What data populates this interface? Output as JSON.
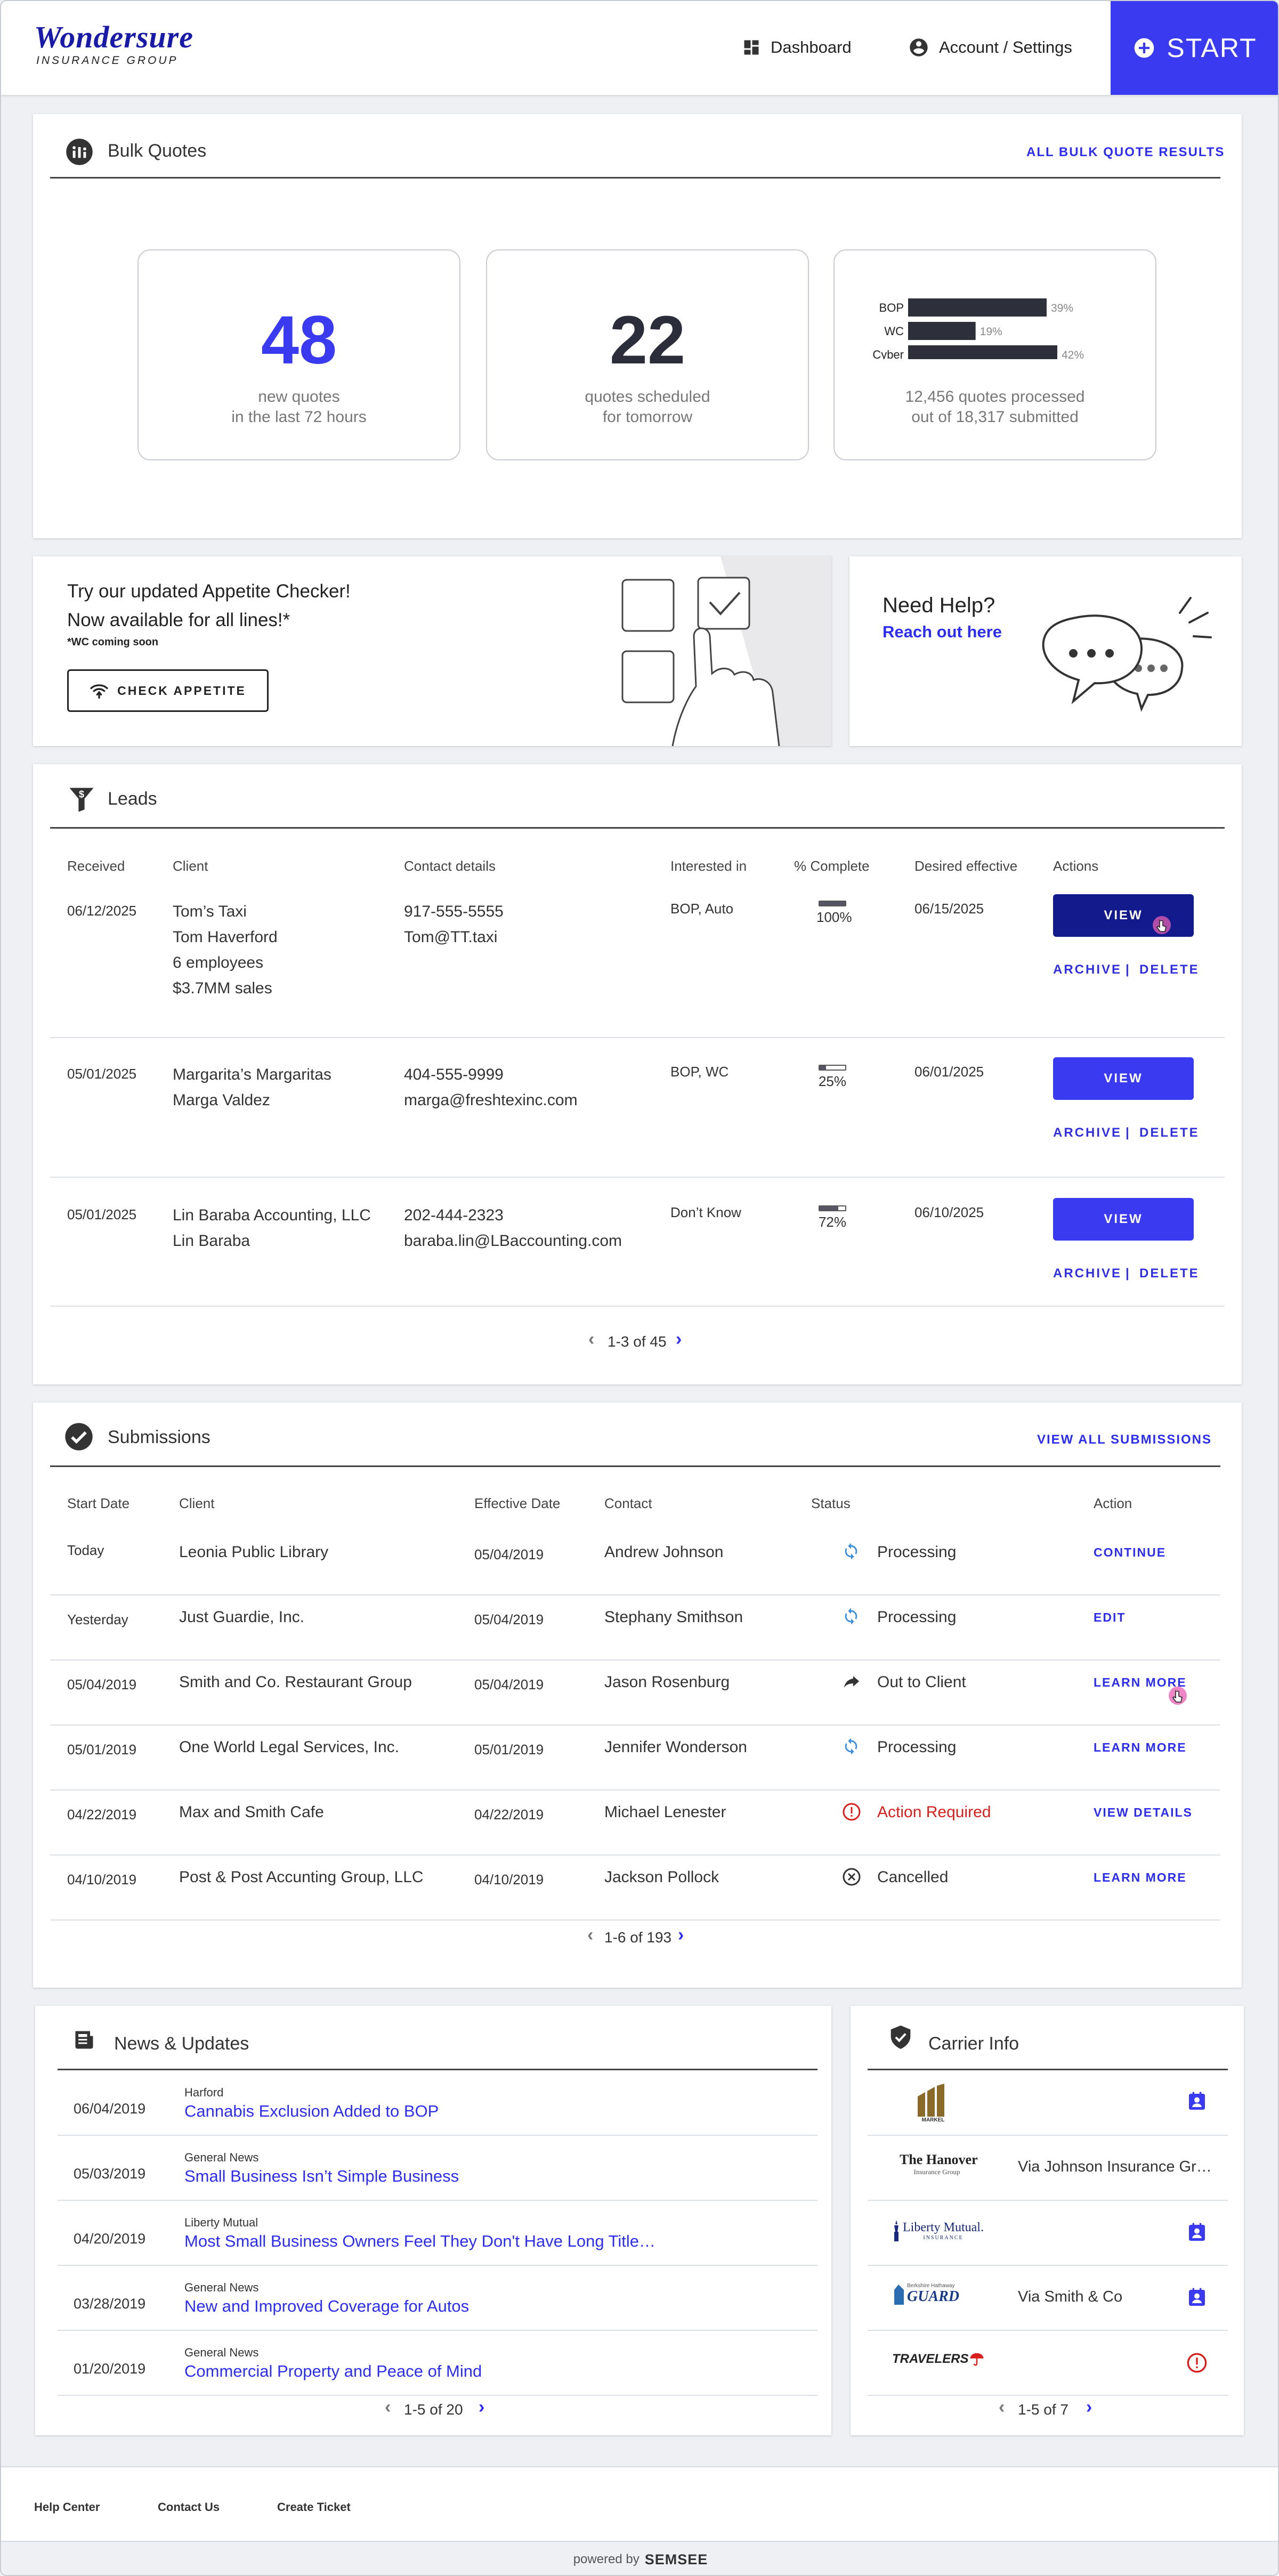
{
  "brand": {
    "name": "Wondersure",
    "tagline": "INSURANCE GROUP"
  },
  "nav": {
    "dashboard": "Dashboard",
    "account": "Account / Settings",
    "start": "START"
  },
  "bulk_quotes": {
    "title": "Bulk Quotes",
    "link": "ALL BULK QUOTE RESULTS",
    "stat1": {
      "value": "48",
      "line1": "new quotes",
      "line2": "in the last 72 hours"
    },
    "stat2": {
      "value": "22",
      "line1": "quotes scheduled",
      "line2": "for tomorrow"
    },
    "stat3": {
      "line1": "12,456 quotes processed",
      "line2": "out of 18,317 submitted"
    }
  },
  "chart_data": {
    "type": "bar",
    "orientation": "horizontal",
    "categories": [
      "BOP",
      "WC",
      "Cyber"
    ],
    "values": [
      39,
      19,
      42
    ],
    "value_labels": [
      "39%",
      "19%",
      "42%"
    ],
    "unit": "%",
    "xlim": [
      0,
      60
    ],
    "bar_color": "#2d2f3a"
  },
  "appetite": {
    "line1": "Try our updated Appetite Checker!",
    "line2": "Now available for all lines!*",
    "note": "*WC coming soon",
    "button": "CHECK APPETITE"
  },
  "help": {
    "title": "Need Help?",
    "link": "Reach out here"
  },
  "leads": {
    "title": "Leads",
    "headers": {
      "received": "Received",
      "client": "Client",
      "contact": "Contact details",
      "interested": "Interested in",
      "complete": "% Complete",
      "effective": "Desired effective",
      "actions": "Actions"
    },
    "rows": [
      {
        "received": "06/12/2025",
        "client": [
          "Tom’s Taxi",
          "Tom Haverford",
          "6 employees",
          "$3.7MM sales"
        ],
        "contact": [
          "917-555-5555",
          "Tom@TT.taxi"
        ],
        "interested": "BOP, Auto",
        "complete": "100%",
        "complete_value": 1.0,
        "effective": "06/15/2025",
        "view": "VIEW",
        "archive": "ARCHIVE",
        "sep": "|",
        "delete": "DELETE"
      },
      {
        "received": "05/01/2025",
        "client": [
          "Margarita’s Margaritas",
          "Marga Valdez"
        ],
        "contact": [
          "404-555-9999",
          "marga@freshtexinc.com"
        ],
        "interested": "BOP, WC",
        "complete": "25%",
        "complete_value": 0.25,
        "effective": "06/01/2025",
        "view": "VIEW",
        "archive": "ARCHIVE",
        "sep": "|",
        "delete": "DELETE"
      },
      {
        "received": "05/01/2025",
        "client": [
          "Lin Baraba Accounting, LLC",
          "Lin Baraba"
        ],
        "contact": [
          "202-444-2323",
          "baraba.lin@LBaccounting.com"
        ],
        "interested": "Don’t Know",
        "complete": "72%",
        "complete_value": 0.72,
        "effective": "06/10/2025",
        "view": "VIEW",
        "archive": "ARCHIVE",
        "sep": "|",
        "delete": "DELETE"
      }
    ],
    "pager": "1-3 of 45"
  },
  "submissions": {
    "title": "Submissions",
    "link": "VIEW ALL SUBMISSIONS",
    "headers": {
      "start": "Start Date",
      "client": "Client",
      "effective": "Effective Date",
      "contact": "Contact",
      "status": "Status",
      "action": "Action"
    },
    "rows": [
      {
        "start": "Today",
        "client": "Leonia Public Library",
        "effective": "05/04/2019",
        "contact": "Andrew Johnson",
        "status": "Processing",
        "status_icon": "refresh-icon",
        "action": "CONTINUE"
      },
      {
        "start": "Yesterday",
        "client": "Just Guardie, Inc.",
        "effective": "05/04/2019",
        "contact": "Stephany Smithson",
        "status": "Processing",
        "status_icon": "refresh-icon",
        "action": "EDIT"
      },
      {
        "start": "05/04/2019",
        "client": "Smith and Co. Restaurant Group",
        "effective": "05/04/2019",
        "contact": "Jason Rosenburg",
        "status": "Out to Client",
        "status_icon": "forward-arrow-icon",
        "action": "LEARN MORE"
      },
      {
        "start": "05/01/2019",
        "client": "One World Legal Services, Inc.",
        "effective": "05/01/2019",
        "contact": "Jennifer Wonderson",
        "status": "Processing",
        "status_icon": "refresh-icon",
        "action": "LEARN MORE"
      },
      {
        "start": "04/22/2019",
        "client": "Max and Smith Cafe",
        "effective": "04/22/2019",
        "contact": "Michael Lenester",
        "status": "Action Required",
        "status_icon": "alert-icon",
        "action": "VIEW DETAILS"
      },
      {
        "start": "04/10/2019",
        "client": "Post & Post Accunting Group, LLC",
        "effective": "04/10/2019",
        "contact": "Jackson Pollock",
        "status": "Cancelled",
        "status_icon": "cancel-circle-icon",
        "action": "LEARN MORE"
      }
    ],
    "pager": "1-6 of 193"
  },
  "news": {
    "title": "News & Updates",
    "items": [
      {
        "date": "06/04/2019",
        "source": "Harford",
        "headline": "Cannabis Exclusion Added to BOP"
      },
      {
        "date": "05/03/2019",
        "source": "General News",
        "headline": "Small Business Isn’t Simple Business"
      },
      {
        "date": "04/20/2019",
        "source": "Liberty Mutual",
        "headline": "Most Small Business Owners Feel They Don't Have Long Title…"
      },
      {
        "date": "03/28/2019",
        "source": "General News",
        "headline": "New and Improved Coverage for Autos"
      },
      {
        "date": "01/20/2019",
        "source": "General News",
        "headline": "Commercial Property and Peace of Mind"
      }
    ],
    "pager": "1-5 of 20"
  },
  "carriers": {
    "title": "Carrier Info",
    "items": [
      {
        "logo": "MARKEL",
        "via": "",
        "icon": "contact-card-icon"
      },
      {
        "logo": "The Hanover",
        "logo_sub": "Insurance Group",
        "via": "Via Johnson Insurance Gr…",
        "icon": ""
      },
      {
        "logo": "Liberty Mutual.",
        "logo_sub": "INSURANCE",
        "via": "",
        "icon": "contact-card-icon"
      },
      {
        "logo": "GUARD",
        "logo_sub": "Berkshire Hathaway",
        "via": "Via Smith & Co",
        "icon": "contact-card-icon"
      },
      {
        "logo": "TRAVELERS",
        "via": "",
        "icon": "alert-icon"
      }
    ],
    "pager": "1-5 of 7"
  },
  "footer": {
    "help": "Help Center",
    "contact": "Contact Us",
    "ticket": "Create Ticket",
    "powered_prefix": "powered by",
    "powered_brand": "SEMSEE"
  },
  "colors": {
    "accent": "#3a3af0",
    "navy": "#131a8c",
    "alert": "#d91e1e",
    "bar": "#2d2f3a"
  }
}
